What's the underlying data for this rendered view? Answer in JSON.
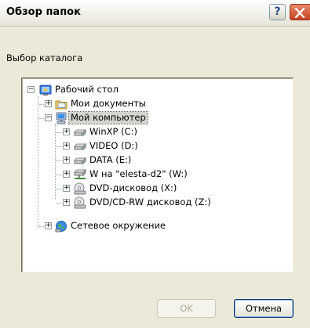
{
  "window": {
    "title": "Обзор папок",
    "help_glyph": "?",
    "close_icon": "close-icon"
  },
  "prompt": "Выбор каталога",
  "tree": {
    "root": {
      "label": "Рабочий стол",
      "icon": "desktop-icon",
      "expander": "−"
    },
    "my_documents": {
      "label": "Мои документы",
      "icon": "folder-icon",
      "expander": "+"
    },
    "my_computer": {
      "label": "Мой компьютер",
      "icon": "computer-icon",
      "expander": "−",
      "selected": true
    },
    "drives": [
      {
        "label": "WinXP (C:)",
        "icon": "hard-drive-icon",
        "expander": "+"
      },
      {
        "label": "VIDEO (D:)",
        "icon": "hard-drive-icon",
        "expander": "+"
      },
      {
        "label": "DATA (E:)",
        "icon": "hard-drive-icon",
        "expander": "+"
      },
      {
        "label": "W на \"elesta-d2\" (W:)",
        "icon": "network-drive-icon",
        "expander": "+"
      },
      {
        "label": "DVD-дисковод (X:)",
        "icon": "dvd-drive-icon",
        "expander": "+"
      },
      {
        "label": "DVD/CD-RW дисковод (Z:)",
        "icon": "dvd-drive-icon",
        "expander": "+"
      }
    ],
    "network": {
      "label": "Сетевое окружение",
      "icon": "network-places-icon",
      "expander": "+"
    }
  },
  "buttons": {
    "ok": "OK",
    "cancel": "Отмена"
  },
  "colors": {
    "face": "#ECE9D8",
    "selection": "#D5D4CE",
    "border": "#7F9DB9",
    "close": "#C6401E"
  }
}
